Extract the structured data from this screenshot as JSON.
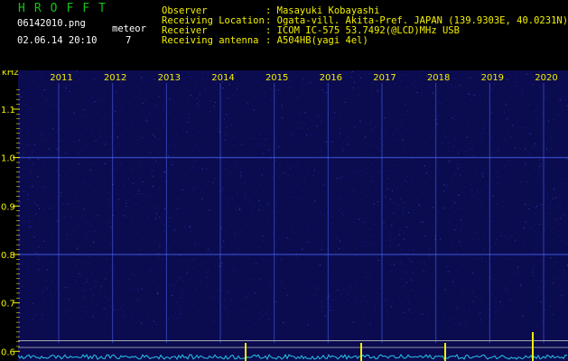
{
  "header": {
    "brand": "HROFFT",
    "filename": "06142010.png",
    "meteor_label": "meteor",
    "timestamp": "02.06.14 20:10",
    "meteor_count": "7",
    "observer_label": "Observer",
    "observer_value": ": Masayuki Kobayashi",
    "location_label": "Receiving Location",
    "location_value": ": Ogata-vill. Akita-Pref. JAPAN (139.9303E, 40.0231N)",
    "receiver_label": "Receiver",
    "receiver_value": ": ICOM IC-575 53.7492(@LCD)MHz USB",
    "antenna_label": "Receiving antenna",
    "antenna_value": ": A504HB(yagi 4el)"
  },
  "chart_data": {
    "type": "heatmap",
    "ylabel": "kHz",
    "x_tick_labels": [
      "2011",
      "2012",
      "2013",
      "2014",
      "2015",
      "2016",
      "2017",
      "2018",
      "2019",
      "2020"
    ],
    "y_tick_labels": [
      "1.1",
      "1.0",
      "0.9",
      "0.8",
      "0.7",
      "0.6"
    ],
    "y_ticks": [
      1.1,
      1.0,
      0.9,
      0.8,
      0.7,
      0.6
    ],
    "ylim": [
      0.58,
      1.18
    ],
    "background_color": "#0b0b50",
    "grid_color": "#20208a",
    "label_color": "#f3f000",
    "signal_color": "#4a6cff"
  }
}
